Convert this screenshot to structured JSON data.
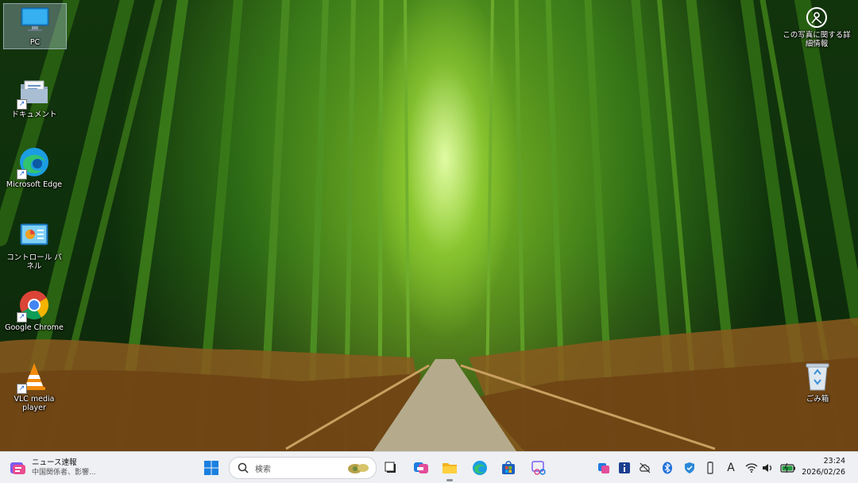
{
  "desktop": {
    "icons": [
      {
        "label": "PC",
        "icon": "monitor-icon"
      },
      {
        "label": "ドキュメント",
        "icon": "documents-folder-icon"
      },
      {
        "label": "Microsoft Edge",
        "icon": "edge-icon"
      },
      {
        "label": "コントロール パネル",
        "icon": "control-panel-icon"
      },
      {
        "label": "Google Chrome",
        "icon": "chrome-icon"
      },
      {
        "label": "VLC media player",
        "icon": "vlc-icon"
      }
    ],
    "spotlight": {
      "label": "この写真に関する詳細情報",
      "icon": "camera-info-icon"
    },
    "recycle_bin": {
      "label": "ごみ箱",
      "icon": "recycle-bin-icon"
    }
  },
  "taskbar": {
    "news": {
      "title": "ニュース速報",
      "subtitle": "中国関係者、影響..."
    },
    "search": {
      "placeholder": "検索"
    },
    "apps": [
      "start-icon",
      "task-view-icon",
      "copilot-icon",
      "file-explorer-icon",
      "edge-icon",
      "store-icon",
      "snipping-tool-icon"
    ],
    "tray": [
      "app-tray-icon",
      "info-icon",
      "cloud-off-icon",
      "bluetooth-icon",
      "security-icon",
      "battery-pen-icon",
      "ime-icon",
      "wifi-icon",
      "speaker-icon",
      "battery-icon"
    ],
    "ime_label": "A",
    "clock": {
      "time": "23:24",
      "date": "2026/02/26"
    }
  }
}
